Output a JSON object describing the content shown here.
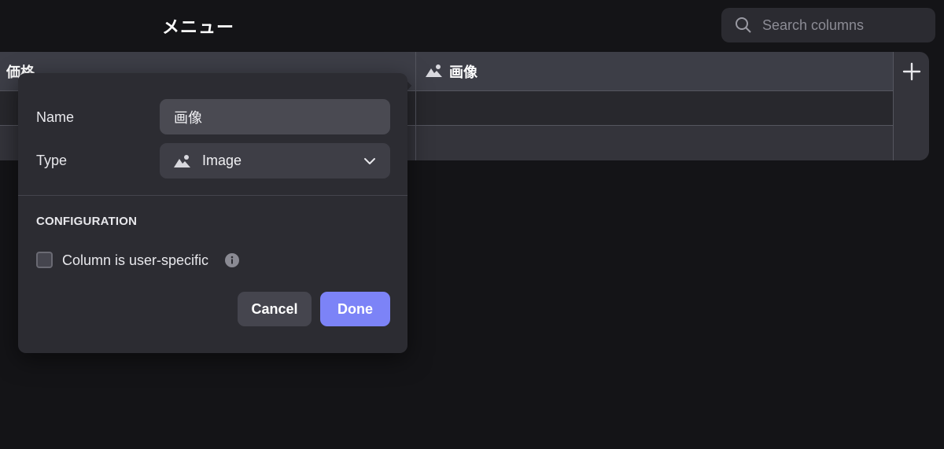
{
  "header": {
    "title": "メニュー",
    "search": {
      "placeholder": "Search columns",
      "icon": "search-icon"
    }
  },
  "table": {
    "columns": [
      {
        "label": "価格"
      },
      {
        "label": "画像",
        "icon": "image-icon"
      }
    ],
    "add_column_icon": "plus-icon"
  },
  "popover": {
    "name_label": "Name",
    "name_value": "画像",
    "type_label": "Type",
    "type_value": "Image",
    "type_icon": "image-icon",
    "section_title": "CONFIGURATION",
    "user_specific_label": "Column is user-specific",
    "user_specific_checked": false,
    "cancel_label": "Cancel",
    "done_label": "Done"
  },
  "colors": {
    "background": "#141417",
    "accent": "#7c83f7",
    "popover_bg": "#2c2c32"
  }
}
